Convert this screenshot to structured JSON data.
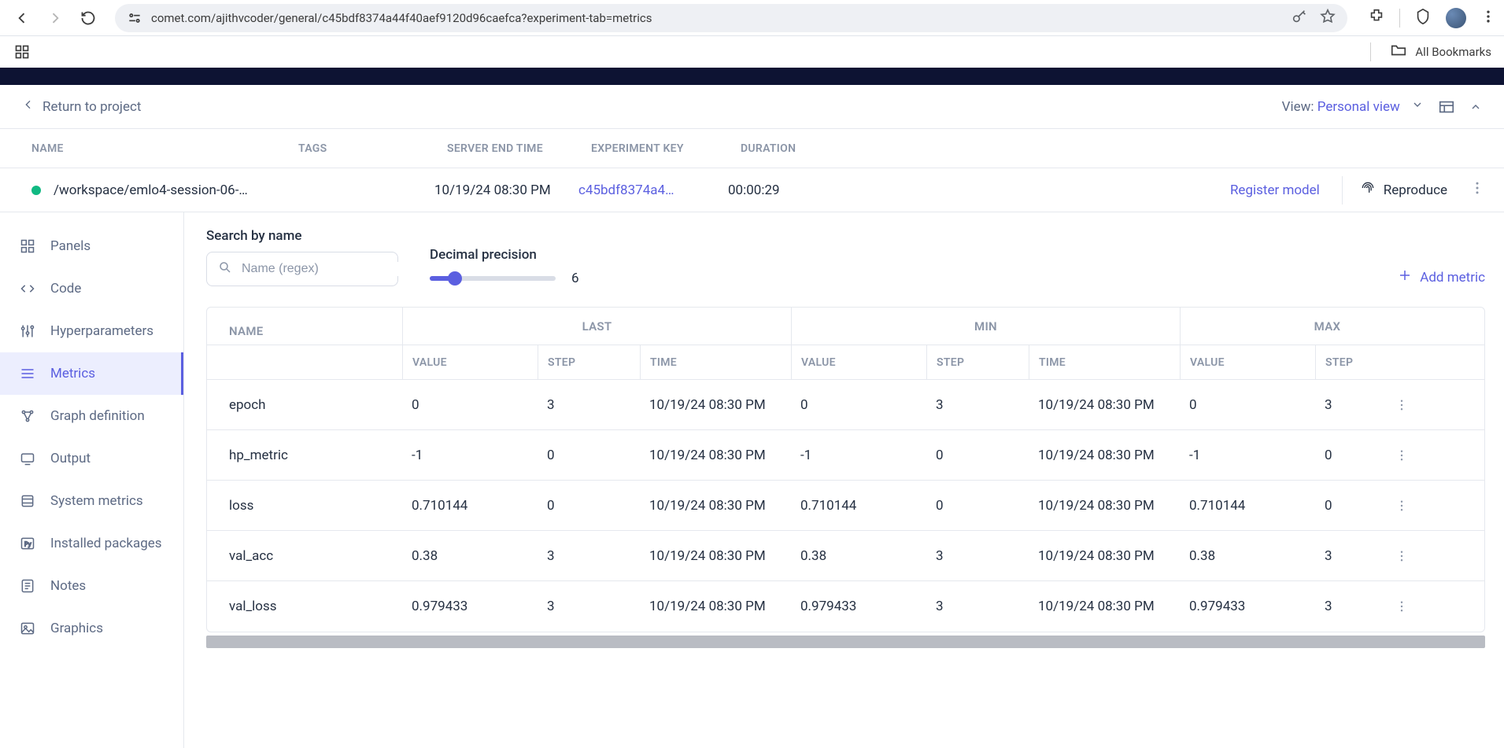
{
  "browser": {
    "url": "comet.com/ajithvcoder/general/c45bdf8374a44f40aef9120d96caefca?experiment-tab=metrics",
    "all_bookmarks": "All Bookmarks"
  },
  "header": {
    "return": "Return to project",
    "view_label": "View: ",
    "view_value": "Personal view"
  },
  "meta_cols": {
    "name": "NAME",
    "tags": "TAGS",
    "server_end": "SERVER END TIME",
    "key": "EXPERIMENT KEY",
    "duration": "DURATION"
  },
  "meta_row": {
    "name": "/workspace/emlo4-session-06-…",
    "server_end": "10/19/24 08:30 PM",
    "key": "c45bdf8374a4…",
    "duration": "00:00:29",
    "register": "Register model",
    "reproduce": "Reproduce"
  },
  "sidebar": {
    "items": [
      {
        "label": "Panels"
      },
      {
        "label": "Code"
      },
      {
        "label": "Hyperparameters"
      },
      {
        "label": "Metrics"
      },
      {
        "label": "Graph definition"
      },
      {
        "label": "Output"
      },
      {
        "label": "System metrics"
      },
      {
        "label": "Installed packages"
      },
      {
        "label": "Notes"
      },
      {
        "label": "Graphics"
      }
    ]
  },
  "controls": {
    "search_label": "Search by name",
    "search_placeholder": "Name (regex)",
    "precision_label": "Decimal precision",
    "precision_value": "6",
    "add_metric": "Add metric"
  },
  "table": {
    "groups": {
      "last": "LAST",
      "min": "MIN",
      "max": "MAX"
    },
    "sub": {
      "name": "NAME",
      "value": "VALUE",
      "step": "STEP",
      "time": "TIME"
    },
    "rows": [
      {
        "name": "epoch",
        "lv": "0",
        "ls": "3",
        "lt": "10/19/24 08:30 PM",
        "mv": "0",
        "ms": "3",
        "mt": "10/19/24 08:30 PM",
        "xv": "0",
        "xs": "3"
      },
      {
        "name": "hp_metric",
        "lv": "-1",
        "ls": "0",
        "lt": "10/19/24 08:30 PM",
        "mv": "-1",
        "ms": "0",
        "mt": "10/19/24 08:30 PM",
        "xv": "-1",
        "xs": "0"
      },
      {
        "name": "loss",
        "lv": "0.710144",
        "ls": "0",
        "lt": "10/19/24 08:30 PM",
        "mv": "0.710144",
        "ms": "0",
        "mt": "10/19/24 08:30 PM",
        "xv": "0.710144",
        "xs": "0"
      },
      {
        "name": "val_acc",
        "lv": "0.38",
        "ls": "3",
        "lt": "10/19/24 08:30 PM",
        "mv": "0.38",
        "ms": "3",
        "mt": "10/19/24 08:30 PM",
        "xv": "0.38",
        "xs": "3"
      },
      {
        "name": "val_loss",
        "lv": "0.979433",
        "ls": "3",
        "lt": "10/19/24 08:30 PM",
        "mv": "0.979433",
        "ms": "3",
        "mt": "10/19/24 08:30 PM",
        "xv": "0.979433",
        "xs": "3"
      }
    ]
  }
}
